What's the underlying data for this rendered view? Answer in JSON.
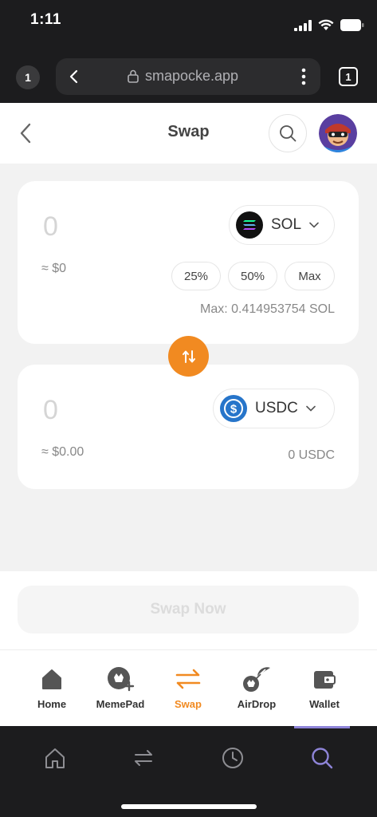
{
  "status_bar": {
    "time": "1:11"
  },
  "browser": {
    "tab_count_left": "1",
    "url": "smapocke.app",
    "tab_count_right": "1"
  },
  "header": {
    "title": "Swap"
  },
  "from_card": {
    "amount": "0",
    "usd_value": "≈ $0",
    "token": "SOL",
    "percent_buttons": [
      "25%",
      "50%",
      "Max"
    ],
    "max_text": "Max: 0.414953754 SOL"
  },
  "to_card": {
    "amount": "0",
    "usd_value": "≈ $0.00",
    "token": "USDC",
    "balance": "0 USDC"
  },
  "swap_button": {
    "label": "Swap Now"
  },
  "app_nav": {
    "items": [
      {
        "label": "Home",
        "icon": "home-icon"
      },
      {
        "label": "MemePad",
        "icon": "memepad-icon"
      },
      {
        "label": "Swap",
        "icon": "swap-arrows-icon",
        "active": true
      },
      {
        "label": "AirDrop",
        "icon": "airdrop-icon"
      },
      {
        "label": "Wallet",
        "icon": "wallet-icon"
      }
    ]
  },
  "browser_toolbar": {
    "icons": [
      "home-icon",
      "swap-icon",
      "history-icon",
      "search-icon"
    ],
    "active": "search-icon"
  },
  "colors": {
    "accent": "#f18a21",
    "sol_bg": "#111111",
    "usdc_blue": "#2775ca",
    "browser_active": "#8e84d8"
  }
}
